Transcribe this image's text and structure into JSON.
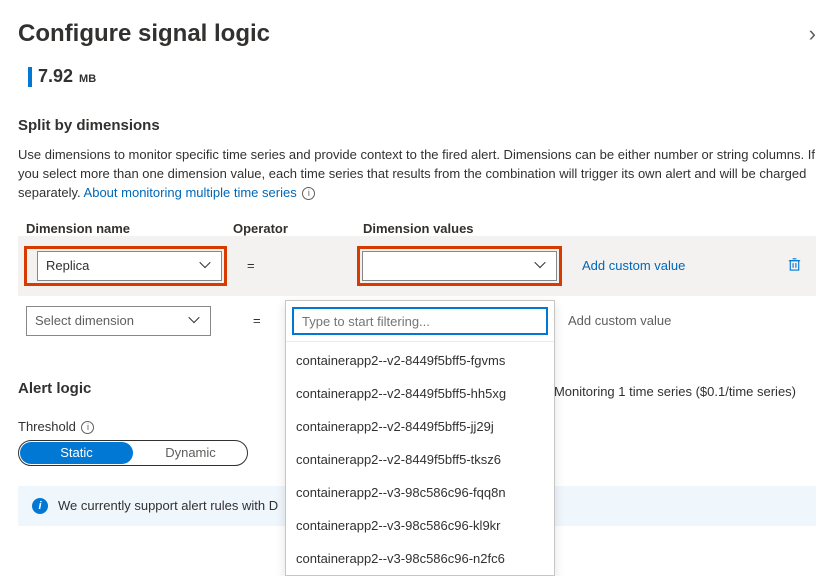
{
  "header": {
    "title": "Configure signal logic"
  },
  "metric": {
    "value": "7.92",
    "unit": "MB"
  },
  "split": {
    "heading": "Split by dimensions",
    "desc": "Use dimensions to monitor specific time series and provide context to the fired alert. Dimensions can be either number or string columns. If you select more than one dimension value, each time series that results from the combination will trigger its own alert and will be charged separately.",
    "link": "About monitoring multiple time series",
    "cols": {
      "name": "Dimension name",
      "op": "Operator",
      "vals": "Dimension values"
    },
    "rows": [
      {
        "name": "Replica",
        "op": "=",
        "value": "",
        "custom": "Add custom value",
        "highlighted": true
      },
      {
        "name_placeholder": "Select dimension",
        "op": "=",
        "value": "",
        "custom": "Add custom value"
      }
    ],
    "dropdown": {
      "filter_placeholder": "Type to start filtering...",
      "options": [
        "containerapp2--v2-8449f5bff5-fgvms",
        "containerapp2--v2-8449f5bff5-hh5xg",
        "containerapp2--v2-8449f5bff5-jj29j",
        "containerapp2--v2-8449f5bff5-tksz6",
        "containerapp2--v3-98c586c96-fqq8n",
        "containerapp2--v3-98c586c96-kl9kr",
        "containerapp2--v3-98c586c96-n2fc6"
      ]
    }
  },
  "alert": {
    "heading": "Alert logic",
    "threshold_label": "Threshold",
    "toggle": {
      "static": "Static",
      "dynamic": "Dynamic"
    },
    "monitoring": "Monitoring 1 time series ($0.1/time series)",
    "banner": "We currently support alert rules with D"
  }
}
